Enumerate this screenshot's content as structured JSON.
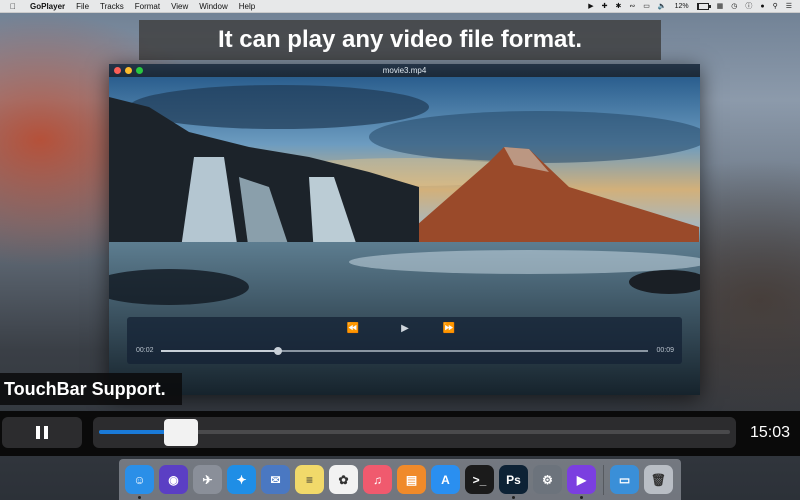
{
  "menubar": {
    "app_name": "GoPlayer",
    "items": [
      "File",
      "Tracks",
      "Format",
      "View",
      "Window",
      "Help"
    ],
    "battery_percent": "12%"
  },
  "captions": {
    "top": "It can play any video file format.",
    "touchbar": "TouchBar Support."
  },
  "player": {
    "window_title": "movie3.mp4",
    "elapsed": "00:02",
    "duration": "00:09",
    "progress": 0.24
  },
  "touchbar": {
    "time": "15:03",
    "progress": 0.13
  },
  "dock": {
    "apps": [
      {
        "name": "finder",
        "label": "☺",
        "color": "#2a8fe8"
      },
      {
        "name": "siri",
        "label": "◉",
        "color": "#5b3fc4"
      },
      {
        "name": "launchpad",
        "label": "✈",
        "color": "#8a8f99"
      },
      {
        "name": "safari",
        "label": "✦",
        "color": "#1f8ee6"
      },
      {
        "name": "mail",
        "label": "✉",
        "color": "#4a78c2"
      },
      {
        "name": "notes",
        "label": "≡",
        "color": "#f1d96a"
      },
      {
        "name": "photos",
        "label": "✿",
        "color": "#f2f2f2"
      },
      {
        "name": "music",
        "label": "♫",
        "color": "#f05a6e"
      },
      {
        "name": "books",
        "label": "▤",
        "color": "#f08a2a"
      },
      {
        "name": "app-store",
        "label": "A",
        "color": "#2a8ff0"
      },
      {
        "name": "terminal",
        "label": ">_",
        "color": "#1b1b1b"
      },
      {
        "name": "photoshop",
        "label": "Ps",
        "color": "#0d2235"
      },
      {
        "name": "system-preferences",
        "label": "⚙",
        "color": "#6c737c"
      },
      {
        "name": "goplayer",
        "label": "▶",
        "color": "#7b3fe0"
      },
      {
        "name": "downloads-folder",
        "label": "▭",
        "color": "#3a8fd8"
      },
      {
        "name": "trash",
        "label": "🗑",
        "color": "#b9bec5"
      }
    ]
  }
}
